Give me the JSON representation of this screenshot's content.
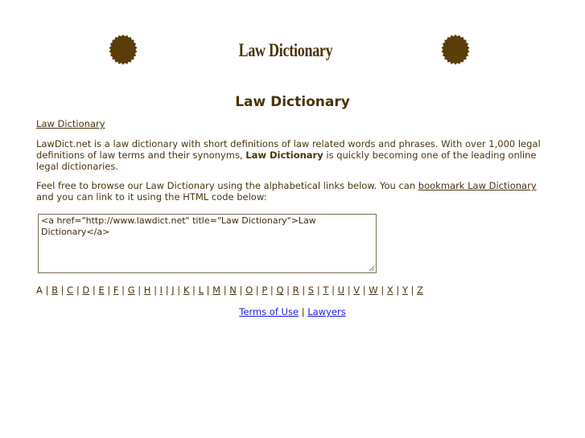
{
  "header": {
    "logo_text": "Law Dictionary",
    "page_title": "Law Dictionary"
  },
  "breadcrumb": {
    "label": "Law Dictionary"
  },
  "intro": {
    "text_before": "LawDict.net is a law dictionary with short definitions of law related words and phrases. With over 1,000 legal definitions of law terms and their synonyms, ",
    "bold": "Law Dictionary",
    "text_after": " is quickly becoming one of the leading online legal dictionaries."
  },
  "browse": {
    "text_before": "Feel free to browse our Law Dictionary using the alphabetical links below. You can ",
    "link": "bookmark Law Dictionary",
    "text_after": " and you can link to it using the HTML code below:"
  },
  "code_box": {
    "value": "<a href=\"http://www.lawdict.net\" title=\"Law Dictionary\">Law Dictionary</a>"
  },
  "alphabet": {
    "current": "A",
    "links": [
      "B",
      "C",
      "D",
      "E",
      "F",
      "G",
      "H",
      "I",
      "J",
      "K",
      "L",
      "M",
      "N",
      "O",
      "P",
      "Q",
      "R",
      "S",
      "T",
      "U",
      "V",
      "W",
      "X",
      "Y",
      "Z"
    ],
    "separator": " | "
  },
  "footer": {
    "terms": "Terms of Use",
    "separator": " | ",
    "lawyers": "Lawyers"
  },
  "colors": {
    "seal": "#5a3d08",
    "text": "#4a3510",
    "footer_link": "#1a1adb"
  }
}
